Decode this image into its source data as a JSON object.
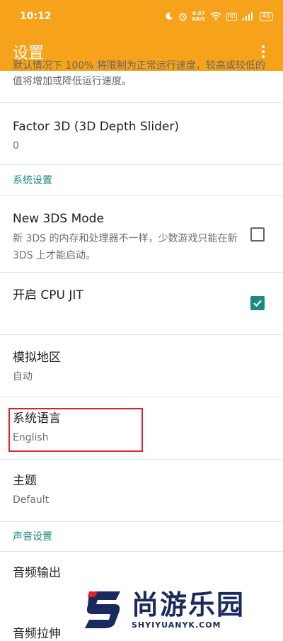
{
  "status_bar": {
    "time": "10:12",
    "net_speed_value": "0.07",
    "net_speed_unit": "KB/S",
    "hd_label": "HD",
    "battery": "48"
  },
  "app_bar": {
    "title": "设置"
  },
  "cut_description": "默认情况下 100% 将限制为正常运行速度，较高或较低的值将增加或降低运行速度。",
  "rows": {
    "factor3d": {
      "title": "Factor 3D (3D Depth Slider)",
      "value": "0"
    },
    "section_system": "系统设置",
    "new3ds": {
      "title": "New 3DS Mode",
      "desc": "新 3DS 的内存和处理器不一样，少数游戏只能在新 3DS 上才能启动。",
      "checked": false
    },
    "cpu_jit": {
      "title": "开启 CPU JIT",
      "checked": true
    },
    "region": {
      "title": "模拟地区",
      "value": "自动"
    },
    "language": {
      "title": "系统语言",
      "value": "English"
    },
    "theme": {
      "title": "主题",
      "value": "Default"
    },
    "section_audio": "声音设置",
    "audio_output": {
      "title": "音频输出"
    },
    "audio_stretch": {
      "title": "音频拉伸"
    }
  },
  "watermark": {
    "cn": "尚游乐园",
    "en": "SHYIYUANYK.COM"
  },
  "colors": {
    "accent": "#f6a31b",
    "teal": "#1c8a80",
    "highlight": "#e0202a"
  }
}
